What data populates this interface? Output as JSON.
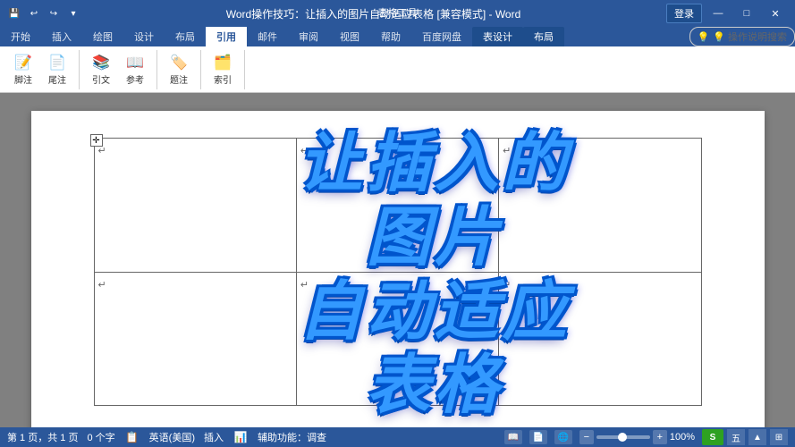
{
  "titleBar": {
    "title": "Word操作技巧：让插入的图片自动适应表格 [兼容模式] - Word",
    "appLabel": "Word",
    "tableToolsLabel": "表格工具",
    "loginBtn": "登录",
    "quickAccessBtns": [
      "↩",
      "↪",
      "▶"
    ],
    "windowControls": [
      "—",
      "□",
      "✕"
    ]
  },
  "ribbonTabs": [
    {
      "label": "开始",
      "active": false
    },
    {
      "label": "插入",
      "active": false
    },
    {
      "label": "绘图",
      "active": false
    },
    {
      "label": "设计",
      "active": false
    },
    {
      "label": "布局",
      "active": false
    },
    {
      "label": "引用",
      "active": true
    },
    {
      "label": "邮件",
      "active": false
    },
    {
      "label": "审阅",
      "active": false
    },
    {
      "label": "视图",
      "active": false
    },
    {
      "label": "帮助",
      "active": false
    },
    {
      "label": "百度网盘",
      "active": false
    },
    {
      "label": "表设计",
      "active": false
    },
    {
      "label": "布局",
      "active": false
    }
  ],
  "ribbonSearch": {
    "placeholder": "💡 操作说明搜索"
  },
  "docContent": {
    "bigText": [
      "让插入的",
      "图片",
      "自动适应",
      "表格"
    ]
  },
  "table": {
    "rows": 2,
    "cols": 3
  },
  "statusBar": {
    "pageInfo": "第 1 页，共 1 页",
    "charCount": "0 个字",
    "langLabel": "英语(美国)",
    "insertLabel": "插入",
    "accessLabel": "辅助功能：调查",
    "zoomLevel": "100%"
  }
}
